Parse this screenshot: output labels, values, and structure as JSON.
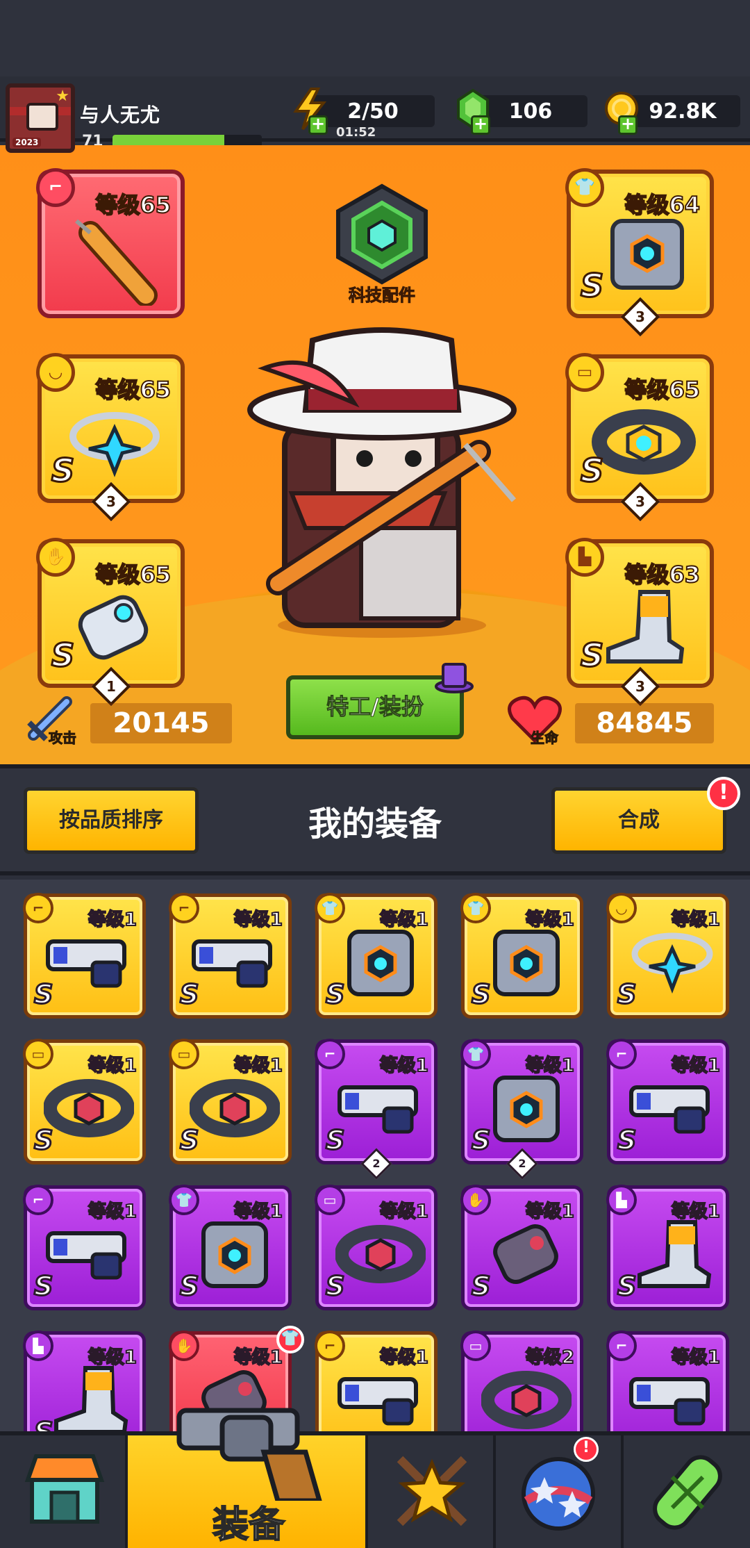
{
  "player": {
    "name": "与人无尤",
    "level": "71",
    "xp_fraction": 0.75,
    "avatar_year": "2023"
  },
  "resources": {
    "energy": {
      "value": "2/50",
      "timer": "01:52"
    },
    "gems": {
      "value": "106"
    },
    "coins": {
      "value": "92.8K"
    }
  },
  "hero": {
    "tech_label": "科技配件",
    "costume_button": "特工/装扮",
    "attack": {
      "label": "攻击",
      "value": "20145"
    },
    "health": {
      "label": "生命",
      "value": "84845"
    },
    "slots": [
      {
        "id": "weapon",
        "type_icon": "gun-type-icon",
        "level": "等级65",
        "grade": "",
        "count": "",
        "rarity": "red"
      },
      {
        "id": "armor",
        "type_icon": "shirt-type-icon",
        "level": "等级64",
        "grade": "S",
        "count": "3",
        "rarity": "gold"
      },
      {
        "id": "necklace",
        "type_icon": "necklace-type-icon",
        "level": "等级65",
        "grade": "S",
        "count": "3",
        "rarity": "gold"
      },
      {
        "id": "belt",
        "type_icon": "belt-type-icon",
        "level": "等级65",
        "grade": "S",
        "count": "3",
        "rarity": "gold"
      },
      {
        "id": "gloves",
        "type_icon": "glove-type-icon",
        "level": "等级65",
        "grade": "S",
        "count": "1",
        "rarity": "gold"
      },
      {
        "id": "boots",
        "type_icon": "boot-type-icon",
        "level": "等级63",
        "grade": "S",
        "count": "3",
        "rarity": "gold"
      }
    ]
  },
  "equipment_section": {
    "sort_button": "按品质排序",
    "title": "我的装备",
    "merge_button": "合成",
    "merge_alert": "!"
  },
  "inventory": [
    {
      "rarity": "gold",
      "type": "gun",
      "level": "等级1",
      "grade": "S",
      "count": ""
    },
    {
      "rarity": "gold",
      "type": "gun",
      "level": "等级1",
      "grade": "S",
      "count": ""
    },
    {
      "rarity": "gold",
      "type": "armor",
      "level": "等级1",
      "grade": "S",
      "count": ""
    },
    {
      "rarity": "gold",
      "type": "armor",
      "level": "等级1",
      "grade": "S",
      "count": ""
    },
    {
      "rarity": "gold",
      "type": "necklace",
      "level": "等级1",
      "grade": "S",
      "count": ""
    },
    {
      "rarity": "gold",
      "type": "belt",
      "level": "等级1",
      "grade": "S",
      "count": ""
    },
    {
      "rarity": "gold",
      "type": "belt",
      "level": "等级1",
      "grade": "S",
      "count": ""
    },
    {
      "rarity": "purple",
      "type": "gun",
      "level": "等级1",
      "grade": "S",
      "count": "2"
    },
    {
      "rarity": "purple",
      "type": "armor",
      "level": "等级1",
      "grade": "S",
      "count": "2"
    },
    {
      "rarity": "purple",
      "type": "gun",
      "level": "等级1",
      "grade": "S",
      "count": ""
    },
    {
      "rarity": "purple",
      "type": "gun",
      "level": "等级1",
      "grade": "S",
      "count": ""
    },
    {
      "rarity": "purple",
      "type": "armor",
      "level": "等级1",
      "grade": "S",
      "count": ""
    },
    {
      "rarity": "purple",
      "type": "belt",
      "level": "等级1",
      "grade": "S",
      "count": ""
    },
    {
      "rarity": "purple",
      "type": "gloves",
      "level": "等级1",
      "grade": "S",
      "count": ""
    },
    {
      "rarity": "purple",
      "type": "boots",
      "level": "等级1",
      "grade": "S",
      "count": ""
    },
    {
      "rarity": "purple",
      "type": "boots",
      "level": "等级1",
      "grade": "S",
      "count": ""
    },
    {
      "rarity": "red",
      "type": "gloves",
      "level": "等级1",
      "grade": "",
      "count": ""
    },
    {
      "rarity": "gold",
      "type": "gun",
      "level": "等级1",
      "grade": "",
      "count": ""
    },
    {
      "rarity": "purple",
      "type": "belt",
      "level": "等级2",
      "grade": "",
      "count": ""
    },
    {
      "rarity": "purple",
      "type": "gun",
      "level": "等级1",
      "grade": "",
      "count": ""
    }
  ],
  "bottom_nav": {
    "tabs": [
      {
        "id": "shop",
        "icon": "shop-icon"
      },
      {
        "id": "equipment",
        "icon": "revolver-icon",
        "label": "装备",
        "active": true
      },
      {
        "id": "battle",
        "icon": "star-swords-icon"
      },
      {
        "id": "talent",
        "icon": "star-ball-icon",
        "alert": "!"
      },
      {
        "id": "gene",
        "icon": "dna-capsule-icon"
      }
    ]
  },
  "colors": {
    "hero_bg": "#ff9a1e",
    "gold_rarity": "#ffc21b",
    "purple_rarity": "#a72be0",
    "red_rarity": "#f23b4c",
    "accent_green": "#5ec52e"
  }
}
